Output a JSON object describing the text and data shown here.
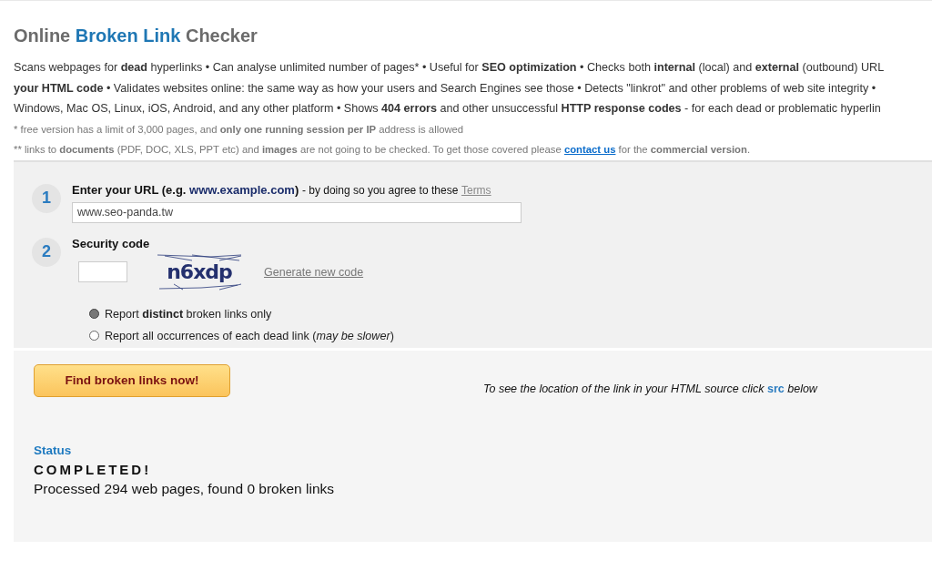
{
  "title": {
    "before": "Online",
    "highlight": "Broken Link",
    "after": "Checker"
  },
  "description": [
    "Scans webpages for **dead** hyperlinks • Can analyse unlimited number of pages* • Useful for **SEO optimization** • Checks both **internal** (local) and **external** (outbound) URL",
    "**your HTML code** • Validates websites online: the same way as how your users and Search Engines see those • Detects \"linkrot\" and other problems of web site integrity •",
    "Windows, Mac OS, Linux, iOS, Android, and any other platform • Shows **404 errors** and other unsuccessful **HTTP response codes** - for each dead or problematic hyperlin"
  ],
  "notes": [
    {
      "text": "*  free version has a limit of 3,000 pages, and **only one running session per IP** address is allowed"
    },
    {
      "text": "** links to **documents** (PDF, DOC, XLS, PPT etc) and **images** are not going to be checked. To get those covered please",
      "link": "contact us",
      "after": "for the **commercial version**."
    }
  ],
  "step1": {
    "number": "1",
    "label": "Enter your URL (e.g.",
    "example": "www.example.com",
    "label_end": ")",
    "agree": "- by doing so you agree to these",
    "terms": "Terms",
    "url": "www.seo-panda.tw"
  },
  "step2": {
    "number": "2",
    "label": "Security code",
    "captcha": "n6xdp",
    "generate": "Generate new code"
  },
  "options": [
    {
      "label": "Report **distinct** broken links only",
      "selected": true
    },
    {
      "label": "Report all occurrences of each dead link (*may be slower*)",
      "selected": false
    }
  ],
  "submit": "Find broken links now!",
  "hint": {
    "text": "To see the location of the link in your HTML source click",
    "keyword": "src",
    "after": "below"
  },
  "status": {
    "heading": "Status",
    "state": "COMPLETED!",
    "summary": "Processed 294 web pages, found 0 broken links"
  }
}
